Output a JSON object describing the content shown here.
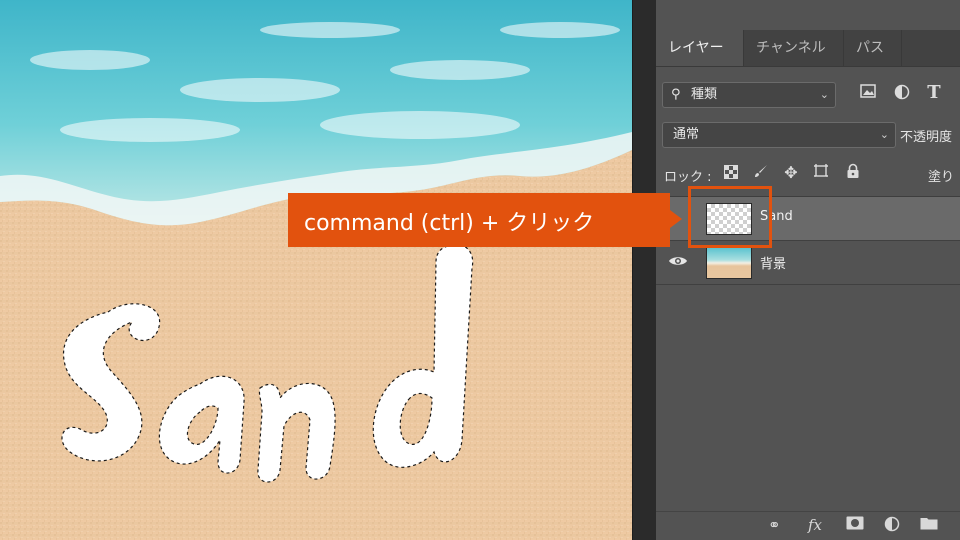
{
  "canvas": {
    "word_icon": "sand-text-selection"
  },
  "panel": {
    "tabs": [
      {
        "label": "レイヤー",
        "active": true
      },
      {
        "label": "チャンネル",
        "active": false
      },
      {
        "label": "パス",
        "active": false
      }
    ],
    "filter": {
      "label": "種類",
      "icon": "search-icon"
    },
    "filter_icons": [
      "image-icon",
      "adjustment-icon",
      "type-icon"
    ],
    "blend": {
      "value": "通常",
      "opacity_label": "不透明度"
    },
    "lock": {
      "label": "ロック :",
      "fill_label": "塗り",
      "icons": [
        "lock-pixels-icon",
        "lock-image-icon",
        "lock-position-icon",
        "lock-artboard-icon",
        "lock-all-icon"
      ]
    },
    "layers": [
      {
        "name": "Sand",
        "selected": true,
        "visible": false
      },
      {
        "name": "背景",
        "selected": false,
        "visible": true
      }
    ],
    "bottom_icons": [
      "link-icon",
      "fx-icon",
      "mask-icon",
      "adjustment-layer-icon",
      "folder-icon"
    ]
  },
  "callout": {
    "text": "command (ctrl) + クリック",
    "color": "#e2520e"
  },
  "colors": {
    "panel_bg": "#535353",
    "tab_bg": "#424242",
    "accent": "#e2520e"
  }
}
